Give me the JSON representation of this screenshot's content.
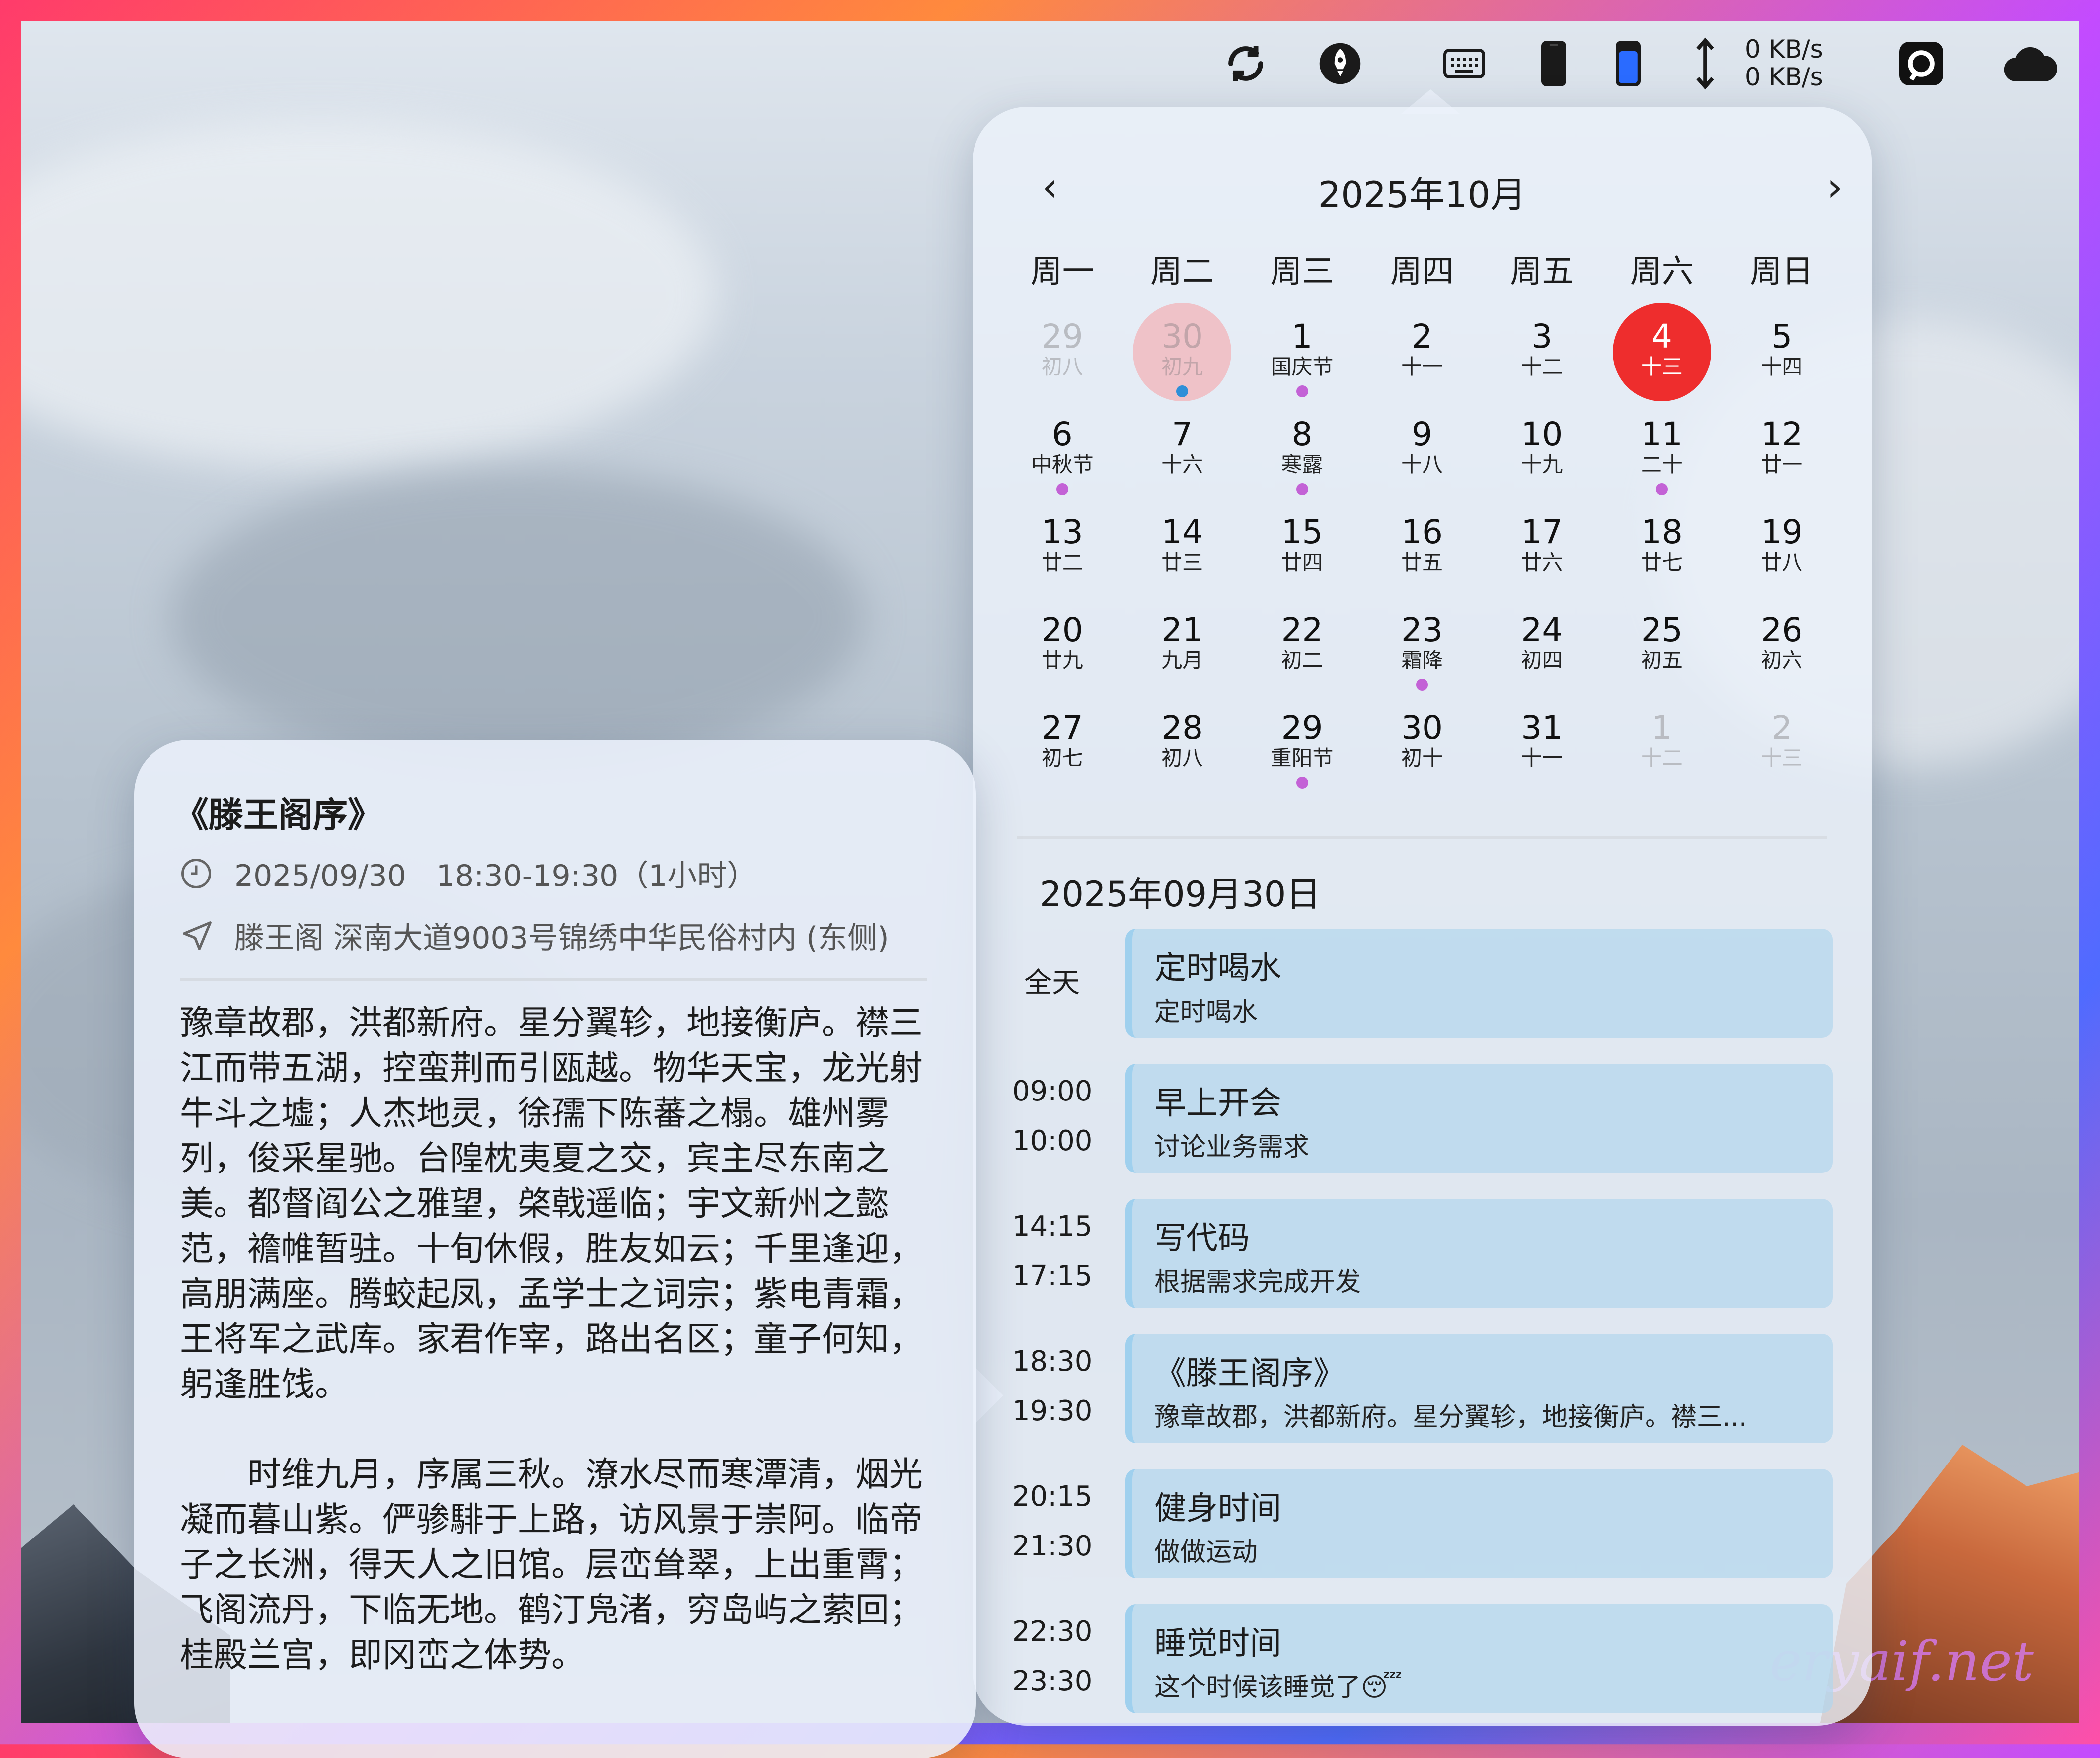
{
  "menubar": {
    "icons": [
      "sync-icon",
      "rocket-icon",
      "keyboard-icon",
      "phone-icon",
      "battery-icon",
      "updown-arrow-icon",
      "screen-app-icon",
      "cloud-icon"
    ],
    "net_up": "0 KB/s",
    "net_down": "0 KB/s"
  },
  "calendar": {
    "title": "2025年10月",
    "prev": "‹",
    "next": "›",
    "weekdays": [
      "周一",
      "周二",
      "周三",
      "周四",
      "周五",
      "周六",
      "周日"
    ],
    "days": [
      {
        "n": "29",
        "l": "初八",
        "state": "other",
        "dot": false
      },
      {
        "n": "30",
        "l": "初九",
        "state": "sel",
        "dot": true
      },
      {
        "n": "1",
        "l": "国庆节",
        "state": "",
        "dot": true
      },
      {
        "n": "2",
        "l": "十一",
        "state": "",
        "dot": false
      },
      {
        "n": "3",
        "l": "十二",
        "state": "",
        "dot": false
      },
      {
        "n": "4",
        "l": "十三",
        "state": "today",
        "dot": false
      },
      {
        "n": "5",
        "l": "十四",
        "state": "",
        "dot": false
      },
      {
        "n": "6",
        "l": "中秋节",
        "state": "",
        "dot": true
      },
      {
        "n": "7",
        "l": "十六",
        "state": "",
        "dot": false
      },
      {
        "n": "8",
        "l": "寒露",
        "state": "",
        "dot": true
      },
      {
        "n": "9",
        "l": "十八",
        "state": "",
        "dot": false
      },
      {
        "n": "10",
        "l": "十九",
        "state": "",
        "dot": false
      },
      {
        "n": "11",
        "l": "二十",
        "state": "",
        "dot": true
      },
      {
        "n": "12",
        "l": "廿一",
        "state": "",
        "dot": false
      },
      {
        "n": "13",
        "l": "廿二",
        "state": "",
        "dot": false
      },
      {
        "n": "14",
        "l": "廿三",
        "state": "",
        "dot": false
      },
      {
        "n": "15",
        "l": "廿四",
        "state": "",
        "dot": false
      },
      {
        "n": "16",
        "l": "廿五",
        "state": "",
        "dot": false
      },
      {
        "n": "17",
        "l": "廿六",
        "state": "",
        "dot": false
      },
      {
        "n": "18",
        "l": "廿七",
        "state": "",
        "dot": false
      },
      {
        "n": "19",
        "l": "廿八",
        "state": "",
        "dot": false
      },
      {
        "n": "20",
        "l": "廿九",
        "state": "",
        "dot": false
      },
      {
        "n": "21",
        "l": "九月",
        "state": "",
        "dot": false
      },
      {
        "n": "22",
        "l": "初二",
        "state": "",
        "dot": false
      },
      {
        "n": "23",
        "l": "霜降",
        "state": "",
        "dot": true
      },
      {
        "n": "24",
        "l": "初四",
        "state": "",
        "dot": false
      },
      {
        "n": "25",
        "l": "初五",
        "state": "",
        "dot": false
      },
      {
        "n": "26",
        "l": "初六",
        "state": "",
        "dot": false
      },
      {
        "n": "27",
        "l": "初七",
        "state": "",
        "dot": false
      },
      {
        "n": "28",
        "l": "初八",
        "state": "",
        "dot": false
      },
      {
        "n": "29",
        "l": "重阳节",
        "state": "",
        "dot": true
      },
      {
        "n": "30",
        "l": "初十",
        "state": "",
        "dot": false
      },
      {
        "n": "31",
        "l": "十一",
        "state": "",
        "dot": false
      },
      {
        "n": "1",
        "l": "十二",
        "state": "other",
        "dot": false
      },
      {
        "n": "2",
        "l": "十三",
        "state": "other",
        "dot": false
      }
    ],
    "selected_date": "2025年09月30日",
    "events": [
      {
        "start": "全天",
        "end": "",
        "title": "定时喝水",
        "desc": "定时喝水"
      },
      {
        "start": "09:00",
        "end": "10:00",
        "title": "早上开会",
        "desc": "讨论业务需求"
      },
      {
        "start": "14:15",
        "end": "17:15",
        "title": "写代码",
        "desc": "根据需求完成开发"
      },
      {
        "start": "18:30",
        "end": "19:30",
        "title": "《滕王阁序》",
        "desc": "豫章故郡，洪都新府。星分翼轸，地接衡庐。襟三..."
      },
      {
        "start": "20:15",
        "end": "21:30",
        "title": "健身时间",
        "desc": "做做运动"
      },
      {
        "start": "22:30",
        "end": "23:30",
        "title": "睡觉时间",
        "desc": "这个时候该睡觉了😴"
      }
    ]
  },
  "popover": {
    "title": "《滕王阁序》",
    "time": "2025/09/30　18:30-19:30（1小时）",
    "location": "滕王阁 深南大道9003号锦绣中华民俗村内 (东侧)",
    "para1": "豫章故郡，洪都新府。星分翼轸，地接衡庐。襟三江而带五湖，控蛮荆而引瓯越。物华天宝，龙光射牛斗之墟；人杰地灵，徐孺下陈蕃之榻。雄州雾列，俊采星驰。台隍枕夷夏之交，宾主尽东南之美。都督阎公之雅望，棨戟遥临；宇文新州之懿范，襜帷暂驻。十旬休假，胜友如云；千里逢迎，高朋满座。腾蛟起凤，孟学士之词宗；紫电青霜，王将军之武库。家君作宰，路出名区；童子何知，躬逢胜饯。",
    "para2": "　　时维九月，序属三秋。潦水尽而寒潭清，烟光凝而暮山紫。俨骖騑于上路，访风景于崇阿。临帝子之长洲，得天人之旧馆。层峦耸翠，上出重霄；飞阁流丹，下临无地。鹤汀凫渚，穷岛屿之萦回；桂殿兰宫，即冈峦之体势。"
  },
  "watermark": "eryaif.net",
  "colors": {
    "today": "#ee2d2d",
    "selected": "#efc2c8",
    "event_dot": "#c362d6",
    "event_card": "#b2d6ec"
  }
}
